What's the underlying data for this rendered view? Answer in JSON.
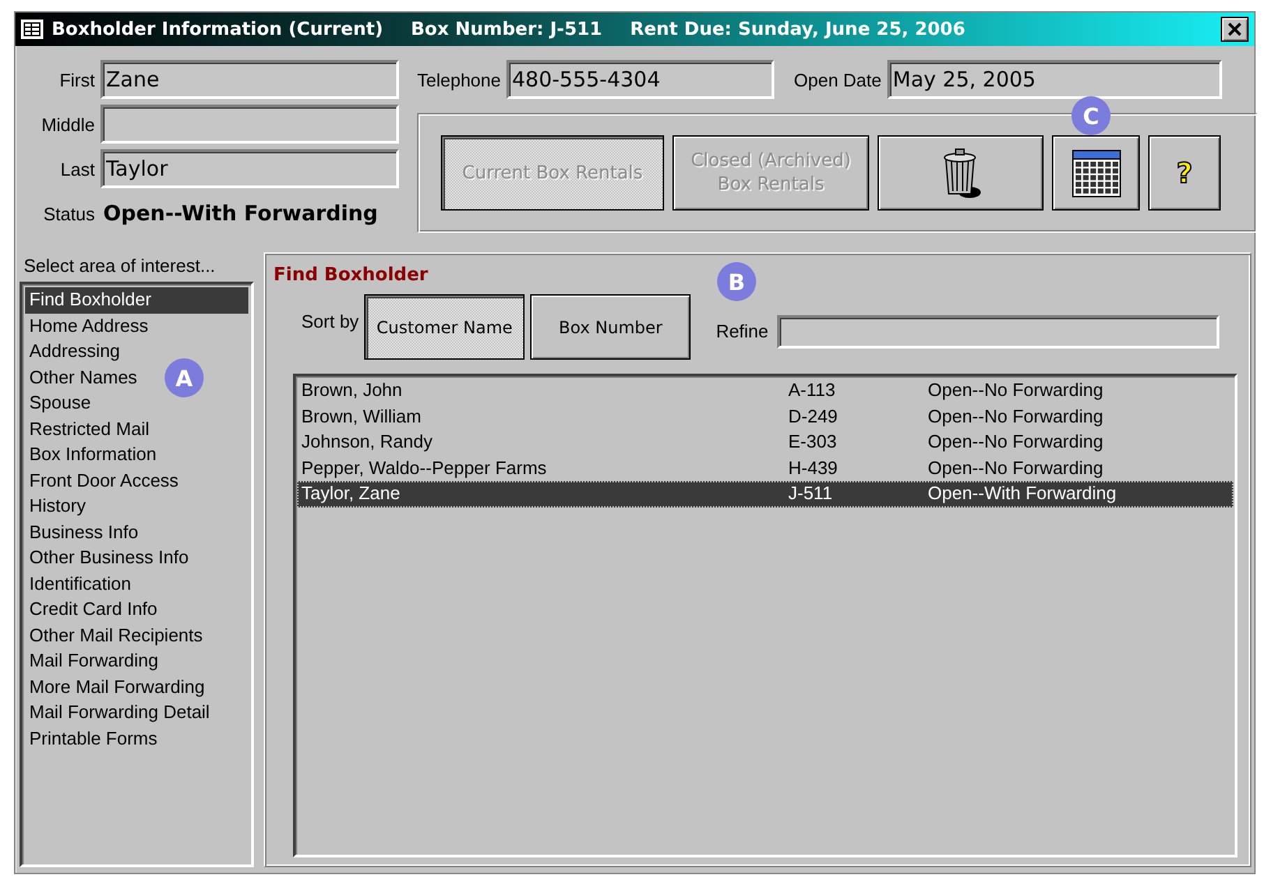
{
  "window": {
    "title": "Boxholder Information (Current)",
    "box_number": "Box Number: J-511",
    "rent_due": "Rent Due: Sunday, June 25, 2006"
  },
  "name_fields": [
    {
      "label": "First",
      "value": "Zane"
    },
    {
      "label": "Middle"
    },
    {
      "label": "Last",
      "value": "Taylor"
    }
  ],
  "status": {
    "label": "Status",
    "value": "Open--With Forwarding"
  },
  "telephone": {
    "label": "Telephone",
    "value": "480-555-4304"
  },
  "open_date": {
    "label": "Open Date",
    "value": "May 25, 2005"
  },
  "toolbar": {
    "callout": "C",
    "buttons": [
      {
        "kind": "text",
        "label": "Current Box Rentals",
        "pressed": true,
        "disabled": true
      },
      {
        "kind": "text",
        "label": "Closed (Archived) Box Rentals",
        "pressed": false,
        "disabled": true
      },
      {
        "kind": "trash",
        "pressed": false,
        "disabled": false
      },
      {
        "kind": "calendar",
        "pressed": false,
        "disabled": false
      },
      {
        "kind": "help",
        "label": "?",
        "pressed": false,
        "disabled": false
      }
    ]
  },
  "sidebar": {
    "heading": "Select area of interest...",
    "callout": "A",
    "items": [
      {
        "label": "Find Boxholder",
        "selected": true
      },
      {
        "label": "Home Address",
        "selected": false
      },
      {
        "label": "Addressing",
        "selected": false
      },
      {
        "label": "Other Names",
        "selected": false
      },
      {
        "label": "Spouse",
        "selected": false
      },
      {
        "label": "Restricted Mail",
        "selected": false
      },
      {
        "label": "Box Information",
        "selected": false
      },
      {
        "label": "Front Door Access",
        "selected": false
      },
      {
        "label": "History",
        "selected": false
      },
      {
        "label": "Business Info",
        "selected": false
      },
      {
        "label": "Other Business Info",
        "selected": false
      },
      {
        "label": "Identification",
        "selected": false
      },
      {
        "label": "Credit Card Info",
        "selected": false
      },
      {
        "label": "Other Mail Recipients",
        "selected": false
      },
      {
        "label": "Mail Forwarding",
        "selected": false
      },
      {
        "label": "More Mail Forwarding",
        "selected": false
      },
      {
        "label": "Mail Forwarding Detail",
        "selected": false
      },
      {
        "label": "Printable Forms",
        "selected": false
      }
    ]
  },
  "find": {
    "title": "Find Boxholder",
    "callout": "B",
    "sort_label": "Sort by",
    "sort_buttons": [
      {
        "label": "Customer Name",
        "selected": true
      },
      {
        "label": "Box Number",
        "selected": false
      }
    ],
    "refine_label": "Refine",
    "rows": [
      {
        "name": "Brown, John",
        "box": "A-113",
        "status": "Open--No Forwarding",
        "selected": false
      },
      {
        "name": "Brown, William",
        "box": "D-249",
        "status": "Open--No Forwarding",
        "selected": false
      },
      {
        "name": "Johnson, Randy",
        "box": "E-303",
        "status": "Open--No Forwarding",
        "selected": false
      },
      {
        "name": "Pepper, Waldo--Pepper Farms",
        "box": "H-439",
        "status": "Open--No Forwarding",
        "selected": false
      },
      {
        "name": "Taylor, Zane",
        "box": "J-511",
        "status": "Open--With Forwarding",
        "selected": true
      }
    ]
  }
}
